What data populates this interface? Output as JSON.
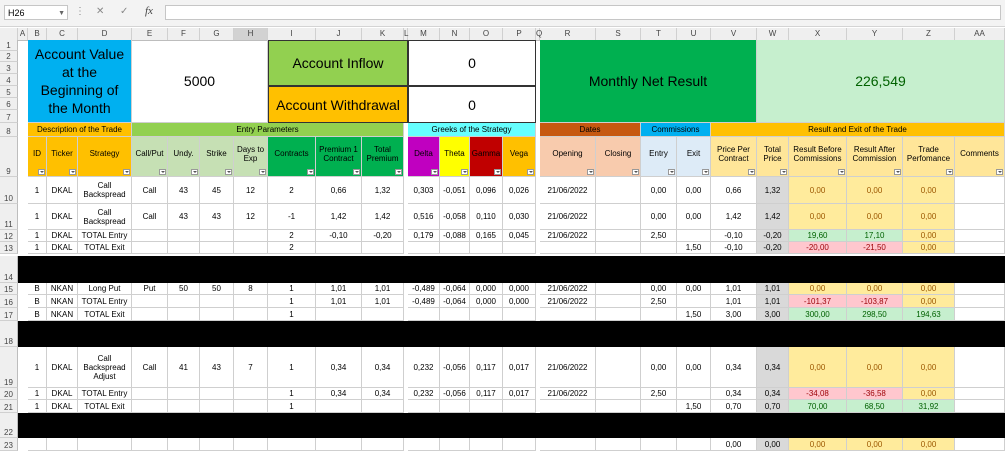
{
  "formula_bar": {
    "name_box": "H26",
    "fx_label": "fx",
    "cancel_glyph": "✕",
    "enter_glyph": "✓"
  },
  "columns": [
    "A",
    "B",
    "C",
    "D",
    "E",
    "F",
    "G",
    "H",
    "I",
    "J",
    "K",
    "L",
    "M",
    "N",
    "O",
    "P",
    "Q",
    "R",
    "S",
    "T",
    "U",
    "V",
    "W",
    "X",
    "Y",
    "Z",
    "AA"
  ],
  "summary": {
    "account_value_label": "Account Value at the Beginning of the Month",
    "account_value": "5000",
    "inflow_label": "Account Inflow",
    "inflow_value": "0",
    "withdrawal_label": "Account Withdrawal",
    "withdrawal_value": "0",
    "net_result_label": "Monthly Net Result",
    "net_result_value": "226,549"
  },
  "sections": {
    "description": "Description of the Trade",
    "entry": "Entry Parameters",
    "greeks": "Greeks of the Strategy",
    "dates": "Dates",
    "commissions": "Commissions",
    "result": "Result and Exit of the Trade"
  },
  "headers": [
    "ID",
    "Ticker",
    "Strategy",
    "Call/Put",
    "Undy.",
    "Strike",
    "Days to Exp",
    "Contracts",
    "Premium 1 Contract",
    "Total Premium",
    "Delta",
    "Theta",
    "Gamma",
    "Vega",
    "Opening",
    "Closing",
    "Entry",
    "Exit",
    "Price Per Contract",
    "Total Price",
    "Result Before Commissions",
    "Result After Commission",
    "Trade Perfomance",
    "Comments"
  ],
  "rows": [
    {
      "n": "10",
      "c": [
        "1",
        "DKAL",
        "Call Backspread",
        "Call",
        "43",
        "45",
        "12",
        "2",
        "0,66",
        "1,32",
        "0,303",
        "-0,051",
        "0,096",
        "0,026",
        "21/06/2022",
        "",
        "0,00",
        "0,00",
        "0,66",
        "1,32",
        "0,00",
        "0,00",
        "0,00",
        ""
      ]
    },
    {
      "n": "11",
      "c": [
        "1",
        "DKAL",
        "Call Backspread",
        "Call",
        "43",
        "43",
        "12",
        "-1",
        "1,42",
        "1,42",
        "0,516",
        "-0,058",
        "0,110",
        "0,030",
        "21/06/2022",
        "",
        "0,00",
        "0,00",
        "1,42",
        "1,42",
        "0,00",
        "0,00",
        "0,00",
        ""
      ]
    },
    {
      "n": "12",
      "c": [
        "1",
        "DKAL",
        "TOTAL Entry",
        "",
        "",
        "",
        "",
        "2",
        "-0,10",
        "-0,20",
        "0,179",
        "-0,088",
        "0,165",
        "0,045",
        "21/06/2022",
        "",
        "2,50",
        "",
        "-0,10",
        "-0,20",
        "19,60",
        "17,10",
        "0,00",
        ""
      ]
    },
    {
      "n": "13",
      "c": [
        "1",
        "DKAL",
        "TOTAL Exit",
        "",
        "",
        "",
        "",
        "2",
        "",
        "",
        "",
        "",
        "",
        "",
        "",
        "",
        "",
        "1,50",
        "-0,10",
        "-0,20",
        "-20,00",
        "-21,50",
        "0,00",
        ""
      ]
    },
    {
      "n": "14",
      "c": []
    },
    {
      "n": "15",
      "c": [
        "B",
        "NKAN",
        "Long Put",
        "Put",
        "50",
        "50",
        "8",
        "1",
        "1,01",
        "1,01",
        "-0,489",
        "-0,064",
        "0,000",
        "0,000",
        "21/06/2022",
        "",
        "0,00",
        "0,00",
        "1,01",
        "1,01",
        "0,00",
        "0,00",
        "0,00",
        ""
      ]
    },
    {
      "n": "16",
      "c": [
        "B",
        "NKAN",
        "TOTAL Entry",
        "",
        "",
        "",
        "",
        "1",
        "1,01",
        "1,01",
        "-0,489",
        "-0,064",
        "0,000",
        "0,000",
        "21/06/2022",
        "",
        "2,50",
        "",
        "1,01",
        "1,01",
        "-101,37",
        "-103,87",
        "0,00",
        ""
      ]
    },
    {
      "n": "17",
      "c": [
        "B",
        "NKAN",
        "TOTAL Exit",
        "",
        "",
        "",
        "",
        "1",
        "",
        "",
        "",
        "",
        "",
        "",
        "",
        "",
        "",
        "1,50",
        "3,00",
        "3,00",
        "300,00",
        "298,50",
        "194,63",
        ""
      ]
    },
    {
      "n": "18",
      "c": []
    },
    {
      "n": "19",
      "c": [
        "1",
        "DKAL",
        "Call Backspread Adjust",
        "Call",
        "41",
        "43",
        "7",
        "1",
        "0,34",
        "0,34",
        "0,232",
        "-0,056",
        "0,117",
        "0,017",
        "21/06/2022",
        "",
        "0,00",
        "0,00",
        "0,34",
        "0,34",
        "0,00",
        "0,00",
        "0,00",
        ""
      ]
    },
    {
      "n": "20",
      "c": [
        "1",
        "DKAL",
        "TOTAL Entry",
        "",
        "",
        "",
        "",
        "1",
        "0,34",
        "0,34",
        "0,232",
        "-0,056",
        "0,117",
        "0,017",
        "21/06/2022",
        "",
        "2,50",
        "",
        "0,34",
        "0,34",
        "-34,08",
        "-36,58",
        "0,00",
        ""
      ]
    },
    {
      "n": "21",
      "c": [
        "1",
        "DKAL",
        "TOTAL Exit",
        "",
        "",
        "",
        "",
        "1",
        "",
        "",
        "",
        "",
        "",
        "",
        "",
        "",
        "",
        "1,50",
        "0,70",
        "0,70",
        "70,00",
        "68,50",
        "31,92",
        ""
      ]
    },
    {
      "n": "22",
      "c": []
    },
    {
      "n": "23",
      "c": [
        "",
        "",
        "",
        "",
        "",
        "",
        "",
        "",
        "",
        "",
        "",
        "",
        "",
        "",
        "",
        "",
        "",
        "",
        "0,00",
        "0,00",
        "0,00",
        "0,00",
        "0,00",
        ""
      ]
    }
  ],
  "colors": {
    "blue": "#00b0f0",
    "green_light": "#92d050",
    "orange": "#ffc000",
    "green_dark": "#00b050",
    "mint": "#c6efce",
    "sec_desc": "#ffc000",
    "sec_entry": "#92d050",
    "sec_greeks": "#66ffff",
    "sec_dates": "#c65911",
    "sec_comm": "#00b0f0",
    "delta": "#c000c0",
    "theta": "#ffff00",
    "gamma": "#c00000",
    "vega": "#ffc000",
    "date_cell": "#f8cbad",
    "comm_cell": "#ddebf7",
    "result_hdr": "#ffe699",
    "pos": "#c6efce",
    "neg": "#ffc7ce",
    "neutral": "#ffeb9c",
    "gray": "#d9d9d9"
  }
}
